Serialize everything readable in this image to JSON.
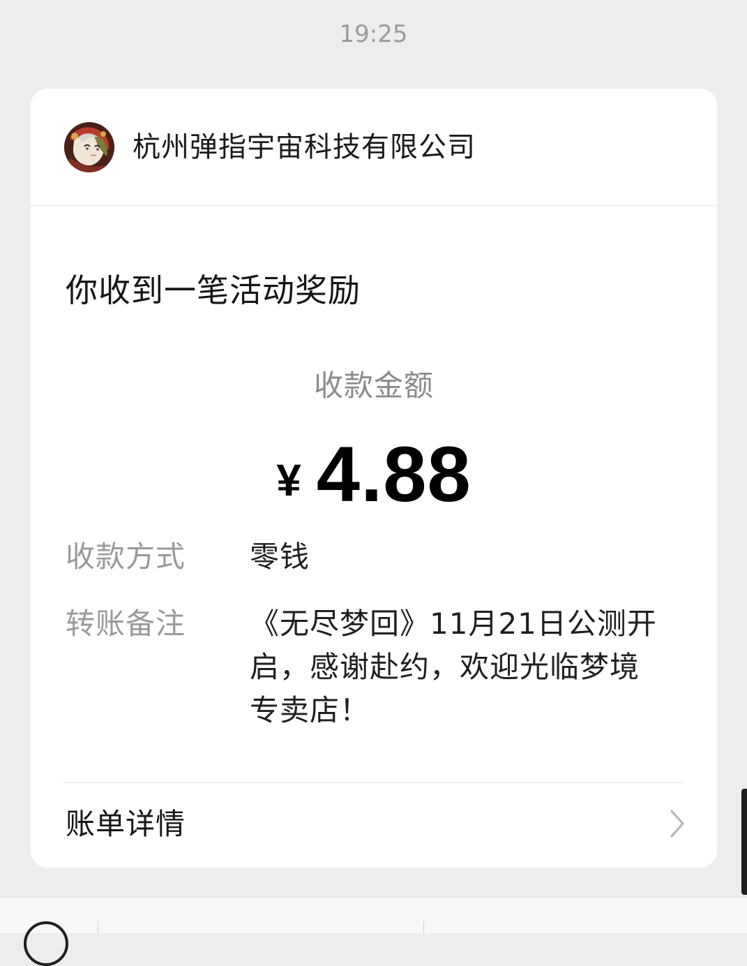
{
  "timestamp": "19:25",
  "card": {
    "merchant": {
      "name": "杭州弹指宇宙科技有限公司",
      "avatar_icon": "merchant-avatar"
    },
    "title": "你收到一笔活动奖励",
    "amount": {
      "label": "收款金额",
      "currency": "¥",
      "value": "4.88"
    },
    "details": [
      {
        "label": "收款方式",
        "value": "零钱"
      },
      {
        "label": "转账备注",
        "value": "《无尽梦回》11月21日公测开启，感谢赴约，欢迎光临梦境专卖店！"
      }
    ],
    "bill_detail_label": "账单详情",
    "bill_detail_icon": "chevron-right-icon"
  },
  "colors": {
    "background": "#ededed",
    "card": "#ffffff",
    "text_primary": "#1a1a1a",
    "text_secondary": "#9a9a9a"
  }
}
